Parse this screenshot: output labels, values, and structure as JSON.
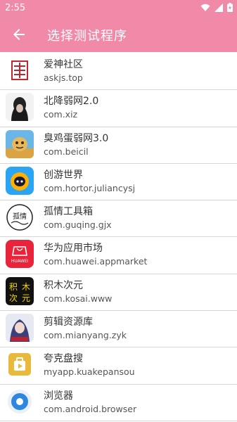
{
  "status": {
    "time": "2:55"
  },
  "appbar": {
    "title": "选择测试程序",
    "back_icon": "arrow-left-icon"
  },
  "apps": [
    {
      "name": "爱神社区",
      "package": "askjs.top"
    },
    {
      "name": "北降弱网2.0",
      "package": "com.xiz"
    },
    {
      "name": "臭鸡蛋弱网3.0",
      "package": "com.beicil"
    },
    {
      "name": "创游世界",
      "package": "com.hortor.juliancysj"
    },
    {
      "name": "孤情工具箱",
      "package": "com.guqing.gjx"
    },
    {
      "name": "华为应用市场",
      "package": "com.huawei.appmarket"
    },
    {
      "name": "积木次元",
      "package": "com.kosai.www"
    },
    {
      "name": "剪辑资源库",
      "package": "com.mianyang.zyk"
    },
    {
      "name": "夸克盘搜",
      "package": "myapp.kuakepansou"
    },
    {
      "name": "浏览器",
      "package": "com.android.browser"
    }
  ],
  "colors": {
    "accent": "#f08aa8"
  }
}
